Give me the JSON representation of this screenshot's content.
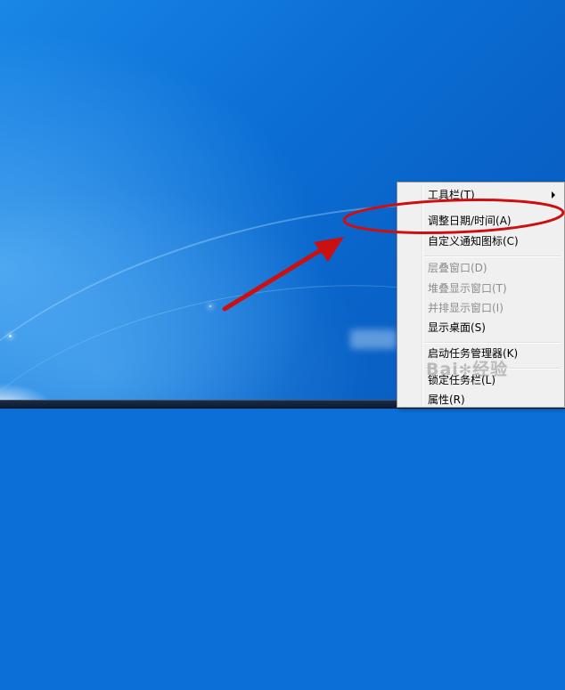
{
  "context_menu": {
    "items": [
      {
        "label": "工具栏(T)",
        "disabled": false,
        "submenu": true
      },
      {
        "label": "调整日期/时间(A)",
        "disabled": false,
        "submenu": false
      },
      {
        "label": "自定义通知图标(C)",
        "disabled": false,
        "submenu": false
      },
      {
        "label": "层叠窗口(D)",
        "disabled": true,
        "submenu": false
      },
      {
        "label": "堆叠显示窗口(T)",
        "disabled": true,
        "submenu": false
      },
      {
        "label": "并排显示窗口(I)",
        "disabled": true,
        "submenu": false
      },
      {
        "label": "显示桌面(S)",
        "disabled": false,
        "submenu": false
      },
      {
        "label": "启动任务管理器(K)",
        "disabled": false,
        "submenu": false
      },
      {
        "label": "锁定任务栏(L)",
        "disabled": false,
        "submenu": false
      },
      {
        "label": "属性(R)",
        "disabled": false,
        "submenu": false
      }
    ]
  },
  "annotation": {
    "color": "#cc1010",
    "highlighted_item": "调整日期/时间(A)"
  },
  "watermark": {
    "brand": "Bai",
    "suffix": "经验",
    "icon": "baidu-paw-icon"
  },
  "colors": {
    "desktop": "#0b6fd5",
    "menu_background": "#f0f0f0",
    "disabled_text": "#8d8d8d"
  }
}
